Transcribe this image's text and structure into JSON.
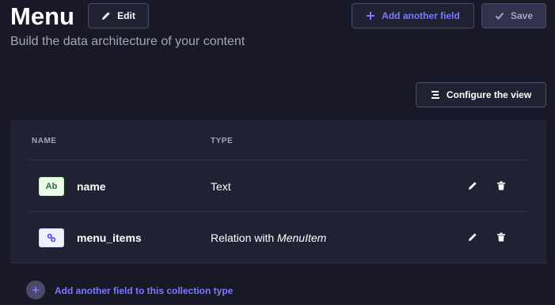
{
  "header": {
    "title": "Menu",
    "subtitle": "Build the data architecture of your content",
    "edit_label": "Edit",
    "add_field_label": "Add another field",
    "save_label": "Save"
  },
  "toolbar": {
    "configure_view_label": "Configure the view"
  },
  "table": {
    "columns": [
      "NAME",
      "TYPE"
    ],
    "rows": [
      {
        "icon": "text-type-icon",
        "icon_text": "Ab",
        "name": "name",
        "type_prefix": "Text",
        "type_target": ""
      },
      {
        "icon": "relation-type-icon",
        "icon_text": "",
        "name": "menu_items",
        "type_prefix": "Relation with ",
        "type_target": "MenuItem"
      }
    ]
  },
  "footer": {
    "add_field_label": "Add another field to this collection type"
  },
  "colors": {
    "background": "#181826",
    "panel": "#212134",
    "accent": "#7b79ff",
    "muted_text": "#a5a5ba"
  }
}
